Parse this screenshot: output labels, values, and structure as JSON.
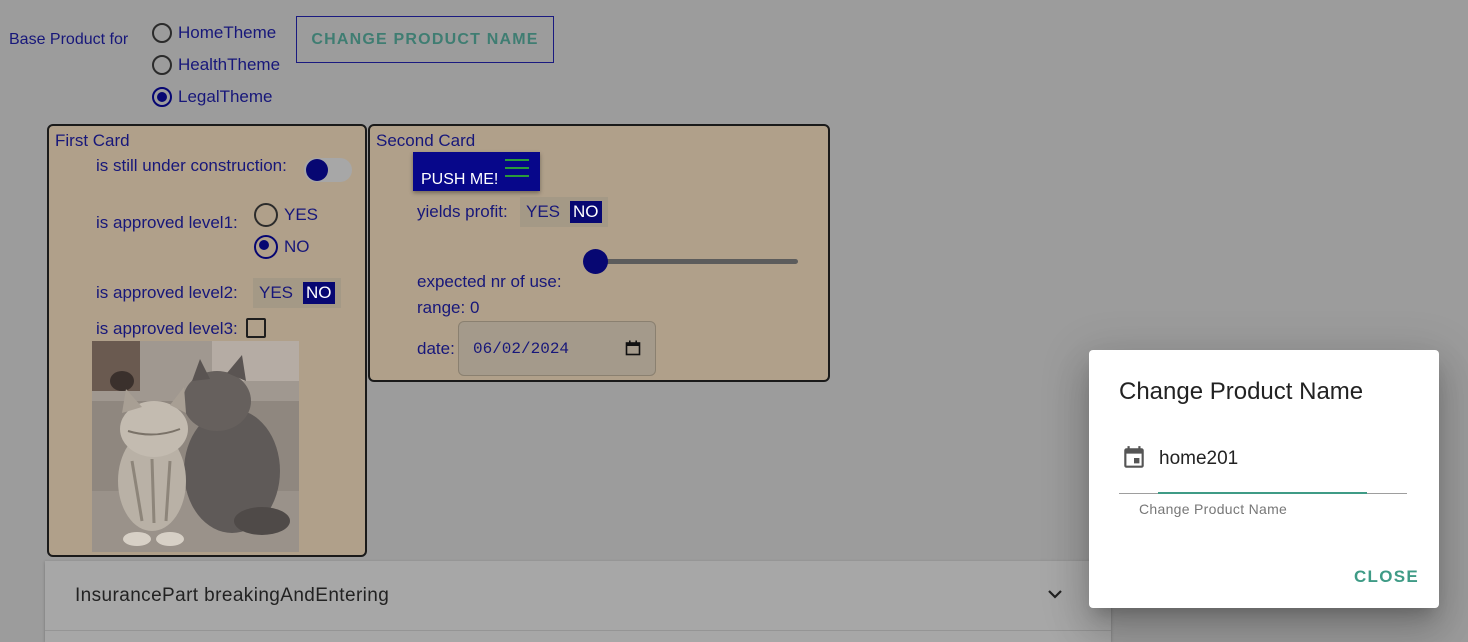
{
  "header": {
    "base_label": "Base Product for",
    "themes": [
      {
        "label": "HomeTheme",
        "selected": false
      },
      {
        "label": "HealthTheme",
        "selected": false
      },
      {
        "label": "LegalTheme",
        "selected": true
      }
    ],
    "change_button": "CHANGE PRODUCT NAME"
  },
  "first_card": {
    "title": "First Card",
    "construction_label": "is still under construction:",
    "construction_on": true,
    "level1_label": "is approved level1:",
    "level1_options": [
      "YES",
      "NO"
    ],
    "level1_selected": "NO",
    "level2_label": "is approved level2:",
    "level2_yes": "YES",
    "level2_no": "NO",
    "level3_label": "is approved level3:",
    "level3_checked": false
  },
  "second_card": {
    "title": "Second Card",
    "push_button": "PUSH ME!",
    "profit_label": "yields profit:",
    "profit_yes": "YES",
    "profit_no": "NO",
    "usage_label": "expected nr of use:",
    "range_label": "range:",
    "range_value": "0",
    "date_label": "date:",
    "date_value": "06/02/2024"
  },
  "accordion": {
    "title": "InsurancePart breakingAndEntering"
  },
  "dialog": {
    "title": "Change Product Name",
    "input_value": "home201",
    "hint": "Change Product Name",
    "close_button": "CLOSE"
  },
  "colors": {
    "overlay_bg": "#9c9c9c",
    "card_bg": "#b0a08a",
    "navy": "#070772",
    "accent_teal": "#3f9b86"
  }
}
